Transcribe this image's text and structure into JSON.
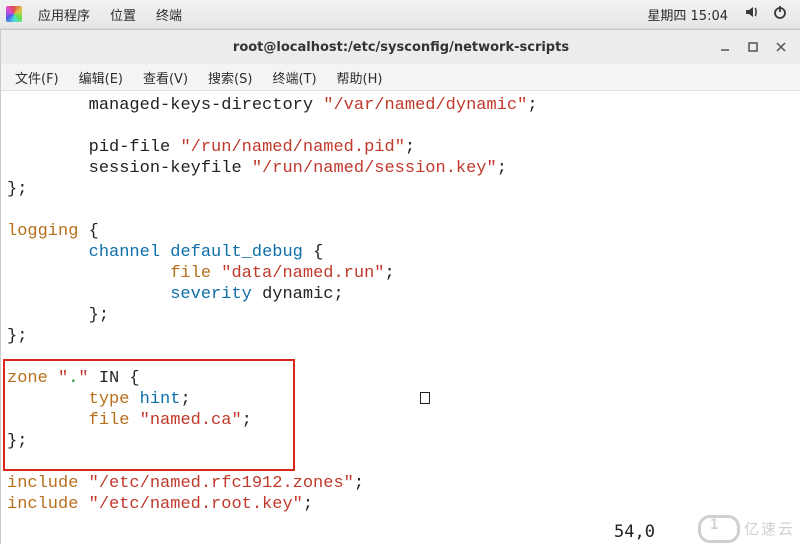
{
  "panel": {
    "app_menu": "应用程序",
    "places_menu": "位置",
    "terminal_menu": "终端",
    "clock": "星期四 15:04"
  },
  "window": {
    "title": "root@localhost:/etc/sysconfig/network-scripts"
  },
  "menubar": {
    "file": "文件(F)",
    "edit": "编辑(E)",
    "view": "查看(V)",
    "search": "搜索(S)",
    "terminal": "终端(T)",
    "help": "帮助(H)"
  },
  "code": {
    "l1_dir": "managed-keys-directory ",
    "l1_str": "\"/var/named/dynamic\"",
    "l2_pid": "pid-file ",
    "l2_str": "\"/run/named/named.pid\"",
    "l3_sk": "session-keyfile ",
    "l3_str": "\"/run/named/session.key\"",
    "l4_close": "};",
    "logging": "logging",
    "channel": "channel",
    "default_debug": "default_debug",
    "file_kw": "file",
    "file_str": "\"data/named.run\"",
    "severity": "severity",
    "severity_val": "dynamic;",
    "zone": "zone",
    "zone_q1": "\"",
    "zone_dot": ".",
    "zone_q2": "\"",
    "zone_in": " IN {",
    "type": "type",
    "hint": "hint",
    "named_ca": "\"named.ca\"",
    "include": "include",
    "inc1": "\"/etc/named.rfc1912.zones\"",
    "inc2": "\"/etc/named.root.key\""
  },
  "status_pos": "54,0",
  "watermark_text": "亿速云"
}
